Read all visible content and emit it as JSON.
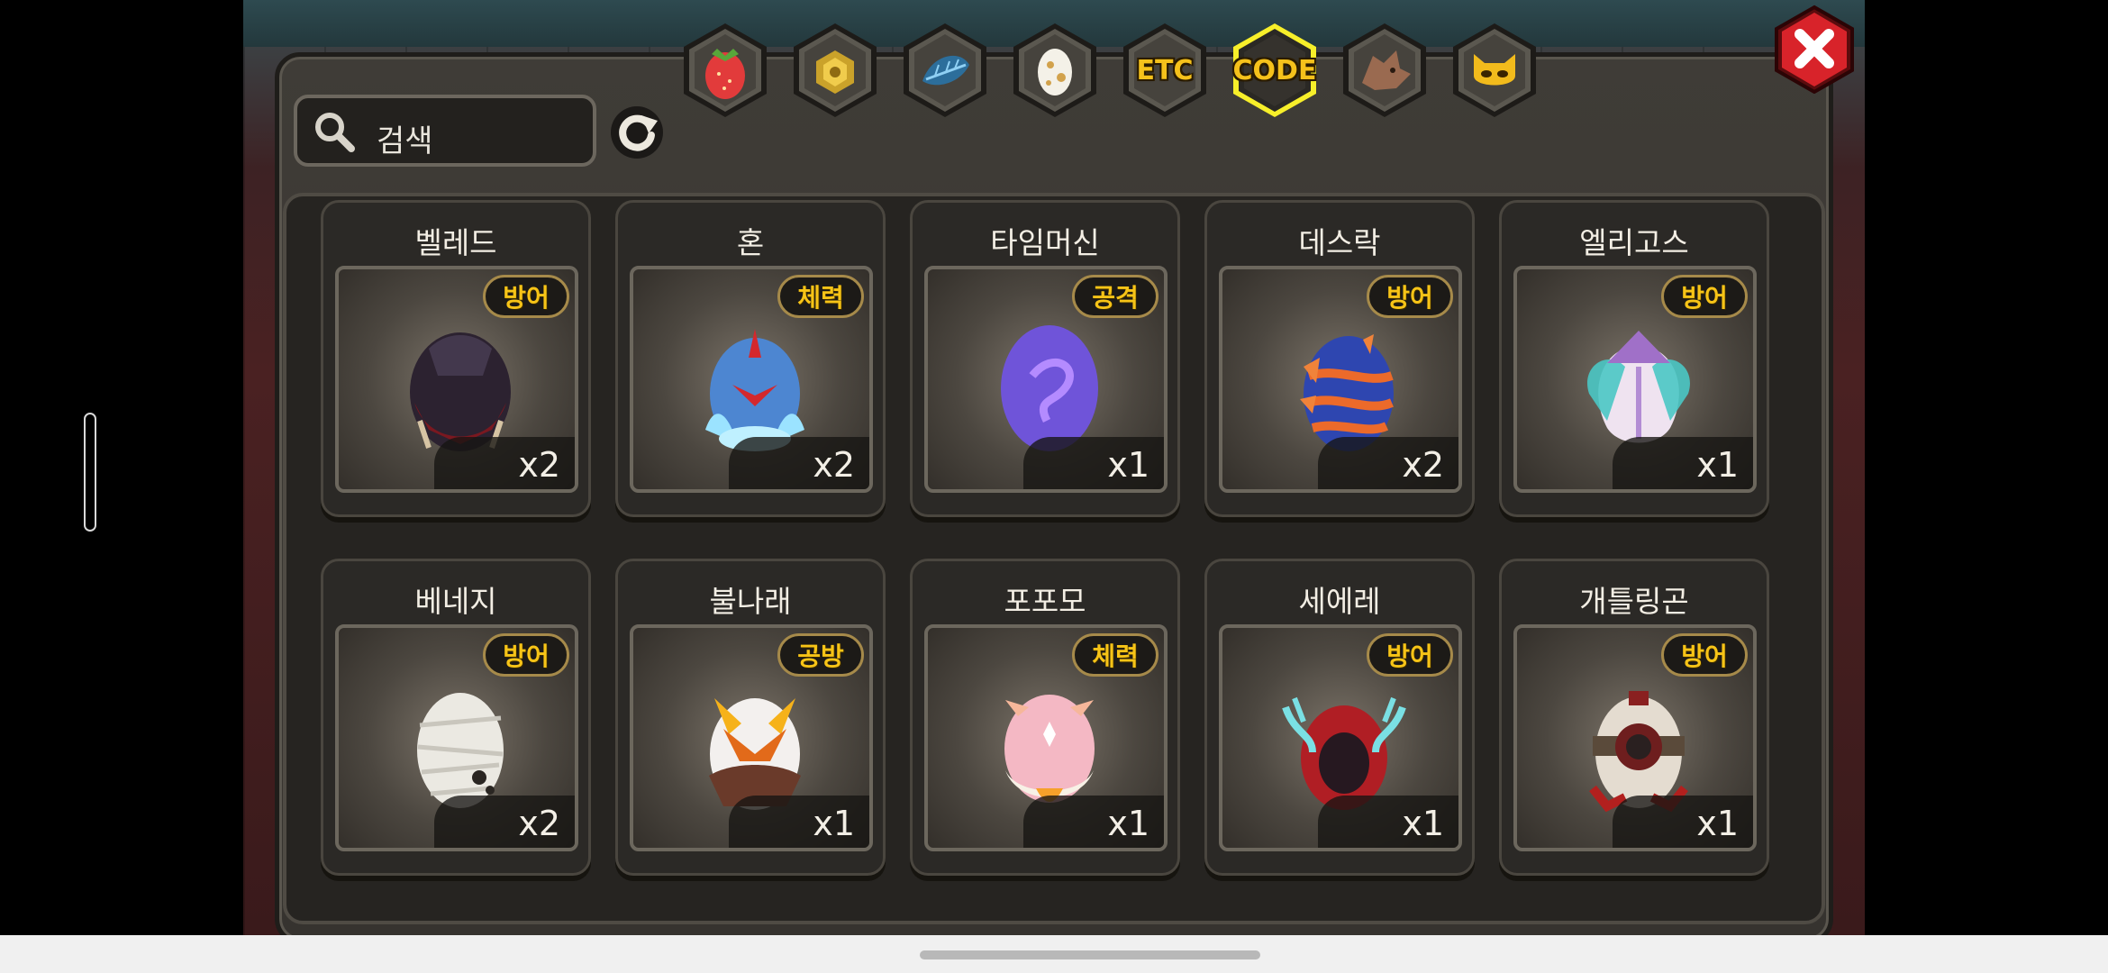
{
  "search": {
    "placeholder": "검색"
  },
  "tabs": [
    {
      "name": "tab-fruit",
      "label": "",
      "icon": "strawberry-icon",
      "active": false
    },
    {
      "name": "tab-coin",
      "label": "",
      "icon": "gold-ore-icon",
      "active": false
    },
    {
      "name": "tab-feather",
      "label": "",
      "icon": "blue-leaf-icon",
      "active": false
    },
    {
      "name": "tab-egg",
      "label": "",
      "icon": "egg-icon",
      "active": false
    },
    {
      "name": "tab-etc",
      "label": "ETC",
      "icon": "",
      "active": false
    },
    {
      "name": "tab-code",
      "label": "CODE",
      "icon": "",
      "active": true
    },
    {
      "name": "tab-dragon",
      "label": "",
      "icon": "dragon-head-icon",
      "active": false
    },
    {
      "name": "tab-mask",
      "label": "",
      "icon": "gold-mask-icon",
      "active": false
    }
  ],
  "items": [
    {
      "name": "벨레드",
      "stat": "방어",
      "count": "x2",
      "icon": "dark-hooded-egg-icon"
    },
    {
      "name": "혼",
      "stat": "체력",
      "count": "x2",
      "icon": "blue-flame-egg-icon"
    },
    {
      "name": "타임머신",
      "stat": "공격",
      "count": "x1",
      "icon": "purple-egg-icon"
    },
    {
      "name": "데스락",
      "stat": "방어",
      "count": "x2",
      "icon": "horned-striped-egg-icon"
    },
    {
      "name": "엘리고스",
      "stat": "방어",
      "count": "x1",
      "icon": "crystal-winged-egg-icon"
    },
    {
      "name": "베네지",
      "stat": "방어",
      "count": "x2",
      "icon": "bandaged-egg-icon"
    },
    {
      "name": "불나래",
      "stat": "공방",
      "count": "x1",
      "icon": "fire-horn-egg-icon"
    },
    {
      "name": "포포모",
      "stat": "체력",
      "count": "x1",
      "icon": "pink-fluffy-egg-icon"
    },
    {
      "name": "세에레",
      "stat": "방어",
      "count": "x1",
      "icon": "red-hooded-egg-icon"
    },
    {
      "name": "개틀링곤",
      "stat": "방어",
      "count": "x1",
      "icon": "armored-gatling-egg-icon"
    }
  ],
  "colors": {
    "accent": "#f5c11b",
    "close": "#d8232a",
    "active_tab_glow": "#f7ef2a"
  }
}
